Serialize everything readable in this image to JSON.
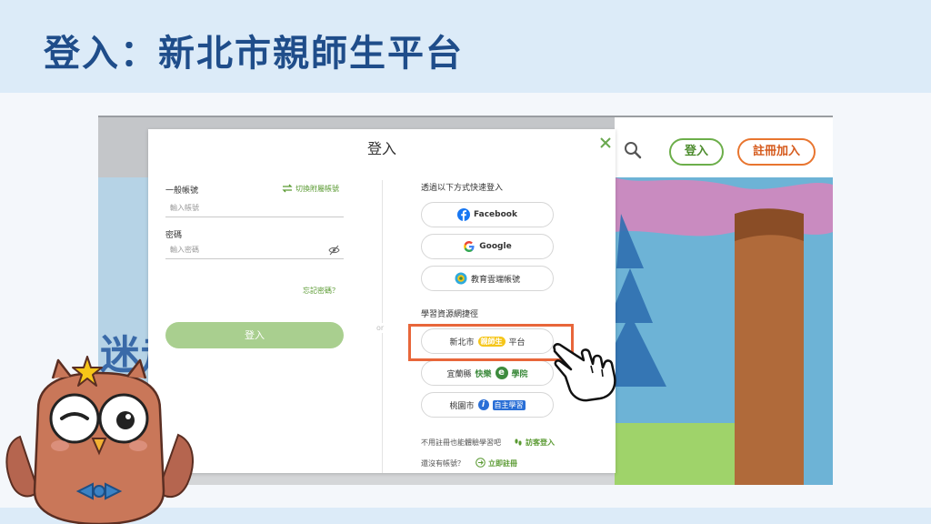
{
  "slide": {
    "title": "登入：新北市親師生平台"
  },
  "site_nav": {
    "login_label": "登入",
    "register_label": "註冊加入"
  },
  "modal": {
    "title": "登入",
    "left": {
      "account_label": "一般帳號",
      "switch_label": "切換附屬帳號",
      "account_placeholder": "輸入帳號",
      "password_label": "密碼",
      "password_placeholder": "輸入密碼",
      "forgot_label": "忘記密碼？",
      "login_button": "登入"
    },
    "or_label": "or",
    "right": {
      "quick_login_label": "透過以下方式快速登入",
      "providers": [
        {
          "label": "Facebook",
          "icon": "facebook-icon"
        },
        {
          "label": "Google",
          "icon": "google-icon"
        },
        {
          "label": "教育雲端帳號",
          "icon": "edu-cloud-icon"
        }
      ],
      "shortcut_label": "學習資源網捷徑",
      "shortcuts": {
        "ntpc_prefix": "新北市",
        "ntpc_badge": "親師生",
        "ntpc_suffix": "平台",
        "yilan_prefix": "宜蘭縣",
        "yilan_word": "快樂",
        "yilan_letter": "e",
        "yilan_suffix": "學院",
        "taoyuan_prefix": "桃園市",
        "taoyuan_letter": "i",
        "taoyuan_box": "自主學習"
      },
      "guest_text": "不用註冊也能體驗學習吧",
      "guest_link": "訪客登入",
      "no_account_text": "還沒有帳號？",
      "register_link": "立即註冊"
    }
  },
  "colors": {
    "title_blue": "#1f4d8a",
    "header_bg": "#dcebf8",
    "brand_green": "#5a9a32",
    "highlight_orange": "#e8663a"
  }
}
